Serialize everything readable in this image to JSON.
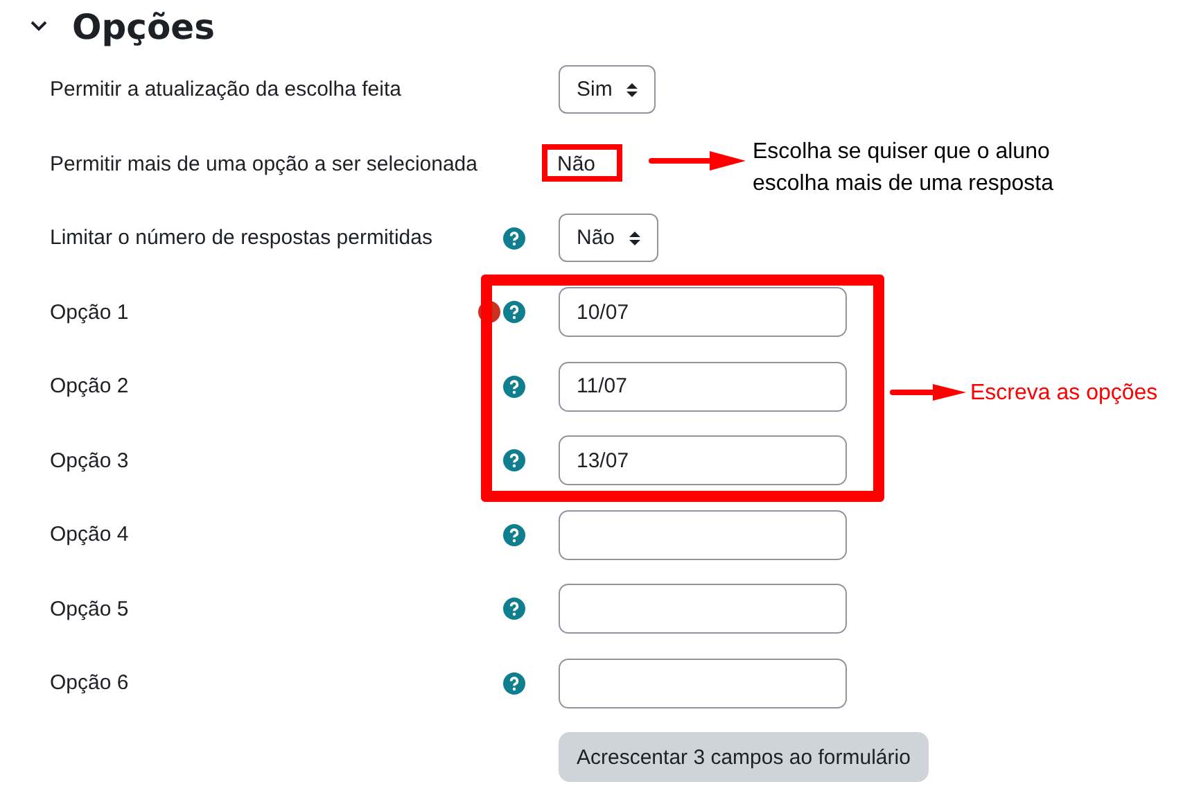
{
  "section": {
    "title": "Opções",
    "expanded": true
  },
  "settings": [
    {
      "kind": "select",
      "label": "Permitir a atualização da escolha feita",
      "value": "Sim",
      "help": false
    },
    {
      "kind": "annotated",
      "label": "Permitir mais de uma opção a ser selecionada",
      "value": "Não",
      "help": false
    },
    {
      "kind": "select",
      "label": "Limitar o número de respostas permitidas",
      "value": "Não",
      "help": true
    }
  ],
  "options": [
    {
      "label": "Opção 1",
      "value": "10/07",
      "error": true
    },
    {
      "label": "Opção 2",
      "value": "11/07",
      "error": false
    },
    {
      "label": "Opção 3",
      "value": "13/07",
      "error": false
    },
    {
      "label": "Opção 4",
      "error": false
    },
    {
      "label": "Opção 5",
      "error": false
    },
    {
      "label": "Opção 6",
      "error": false
    }
  ],
  "add_button": "Acrescentar 3 campos ao formulário",
  "annotations": [
    {
      "kind": "note",
      "text": "Escolha se quiser que o aluno escolha mais de uma resposta",
      "color": "#000000"
    },
    {
      "kind": "note",
      "text": "Escreva as opções",
      "color": "#ff0000"
    }
  ]
}
